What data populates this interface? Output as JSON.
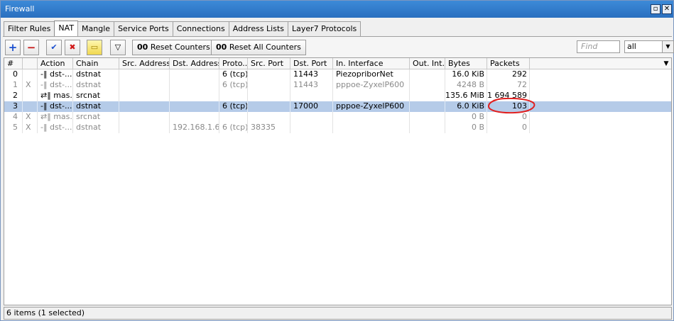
{
  "window": {
    "title": "Firewall",
    "restore_glyph": "▫",
    "close_glyph": "✕"
  },
  "tabs": [
    "Filter Rules",
    "NAT",
    "Mangle",
    "Service Ports",
    "Connections",
    "Address Lists",
    "Layer7 Protocols"
  ],
  "active_tab": "NAT",
  "toolbar": {
    "add_glyph": "+",
    "remove_glyph": "−",
    "enable_glyph": "✔",
    "disable_glyph": "✖",
    "comment_glyph": "▭",
    "filter_glyph": "▽",
    "reset_counters_icon": "00",
    "reset_counters": "Reset Counters",
    "reset_all_icon": "00",
    "reset_all_counters": "Reset All Counters",
    "find_placeholder": "Find",
    "filter_value": "all",
    "dropdown_glyph": "▼"
  },
  "columns": [
    "#",
    "",
    "Action",
    "Chain",
    "Src. Address",
    "Dst. Address",
    "Proto...",
    "Src. Port",
    "Dst. Port",
    "In. Interface",
    "Out. Int...",
    "Bytes",
    "Packets"
  ],
  "header_menu_glyph": "▼",
  "rows": [
    {
      "num": "0",
      "flag": "",
      "action": "-‖ dst-...",
      "chain": "dstnat",
      "src_address": "",
      "dst_address": "",
      "proto": "6 (tcp)",
      "src_port": "",
      "dst_port": "11443",
      "in_interface": "PiezopriborNet",
      "out_interface": "",
      "bytes": "16.0 KiB",
      "packets": "292"
    },
    {
      "num": "1",
      "flag": "X",
      "action": "-‖ dst-...",
      "chain": "dstnat",
      "src_address": "",
      "dst_address": "",
      "proto": "6 (tcp)",
      "src_port": "",
      "dst_port": "11443",
      "in_interface": "pppoe-ZyxelP600",
      "out_interface": "",
      "bytes": "4248 B",
      "packets": "72"
    },
    {
      "num": "2",
      "flag": "",
      "action": "⇄‖ mas...",
      "chain": "srcnat",
      "src_address": "",
      "dst_address": "",
      "proto": "",
      "src_port": "",
      "dst_port": "",
      "in_interface": "",
      "out_interface": "",
      "bytes": "135.6 MiB",
      "packets": "1 694 589"
    },
    {
      "num": "3",
      "flag": "",
      "action": "-‖ dst-...",
      "chain": "dstnat",
      "src_address": "",
      "dst_address": "",
      "proto": "6 (tcp)",
      "src_port": "",
      "dst_port": "17000",
      "in_interface": "pppoe-ZyxelP600",
      "out_interface": "",
      "bytes": "6.0 KiB",
      "packets": "103"
    },
    {
      "num": "4",
      "flag": "X",
      "action": "⇄‖ mas...",
      "chain": "srcnat",
      "src_address": "",
      "dst_address": "",
      "proto": "",
      "src_port": "",
      "dst_port": "",
      "in_interface": "",
      "out_interface": "",
      "bytes": "0 B",
      "packets": "0"
    },
    {
      "num": "5",
      "flag": "X",
      "action": "-‖ dst-...",
      "chain": "dstnat",
      "src_address": "",
      "dst_address": "192.168.1.6",
      "proto": "6 (tcp)",
      "src_port": "38335",
      "dst_port": "",
      "in_interface": "",
      "out_interface": "",
      "bytes": "0 B",
      "packets": "0"
    }
  ],
  "selected_row": 3,
  "status_text": "6 items (1 selected)",
  "colors": {
    "selection": "#b5cbe8",
    "annotation_circle": "#e02020",
    "titlebar": "#2a6fbf"
  }
}
